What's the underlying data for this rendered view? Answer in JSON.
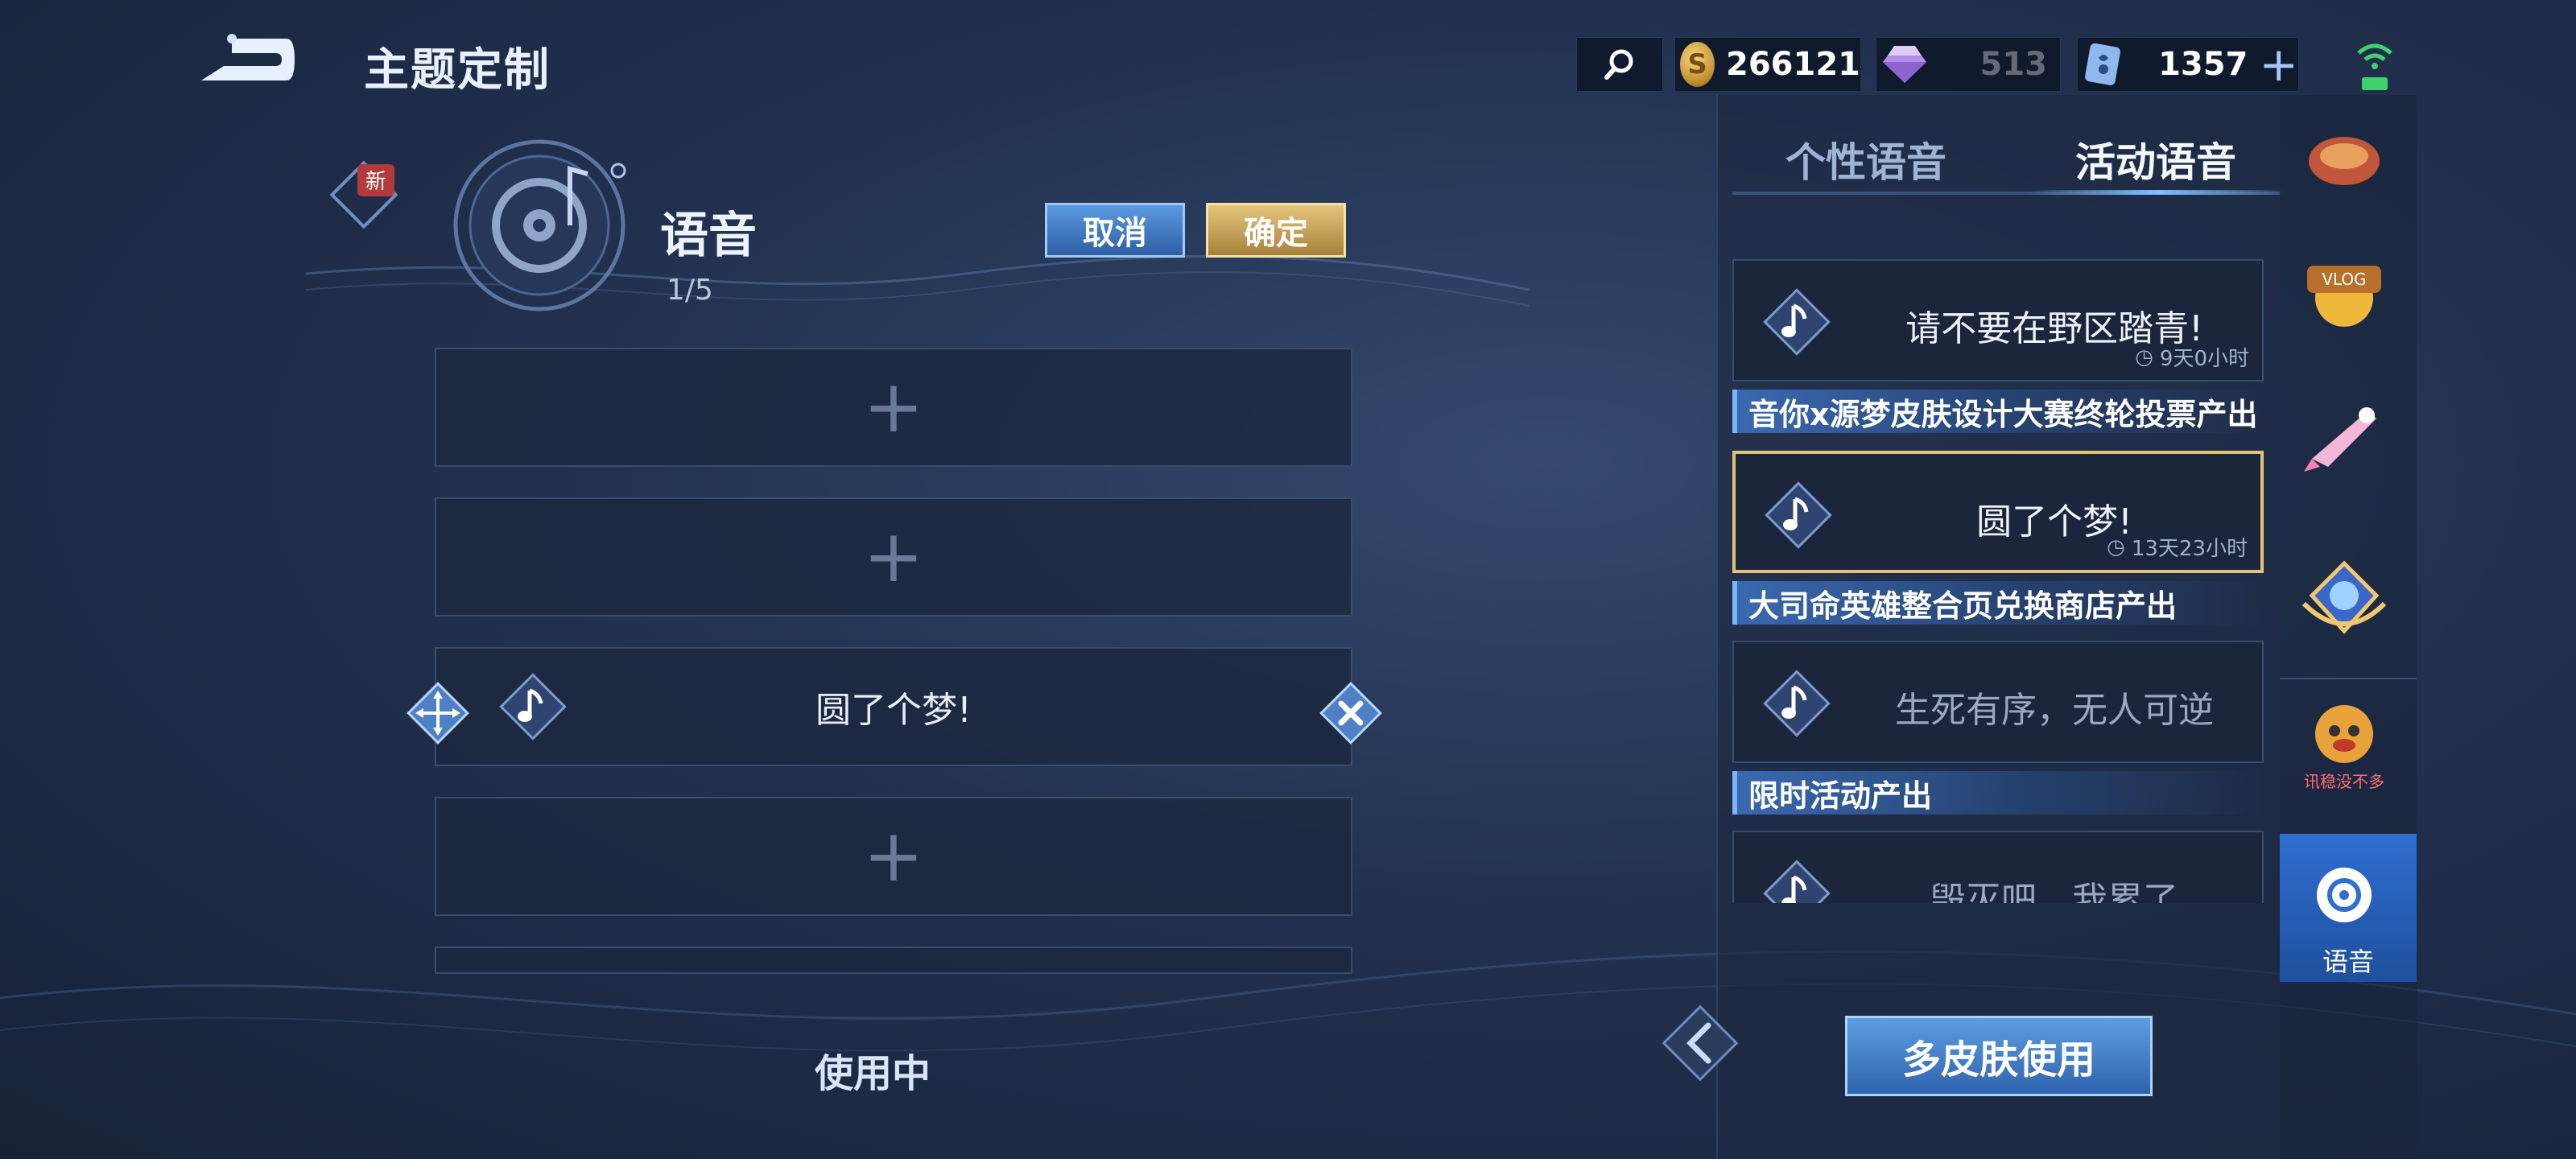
{
  "header": {
    "title": "主题定制",
    "currencies": {
      "gold": "266121",
      "gems": "513",
      "coupons": "1357"
    }
  },
  "voice_section": {
    "title": "语音",
    "count": "1/5",
    "cancel_label": "取消",
    "confirm_label": "确定",
    "new_badge": "新",
    "slots": [
      {
        "filled": false,
        "text": ""
      },
      {
        "filled": false,
        "text": ""
      },
      {
        "filled": true,
        "text": "圆了个梦!"
      },
      {
        "filled": false,
        "text": ""
      }
    ],
    "status": "使用中"
  },
  "right_panel": {
    "tabs": [
      {
        "label": "个性语音",
        "active": false
      },
      {
        "label": "活动语音",
        "active": true
      }
    ],
    "cards": [
      {
        "text": "请不要在野区踏青!",
        "timer": "9天0小时",
        "source": "音你x源梦皮肤设计大赛终轮投票产出"
      },
      {
        "text": "圆了个梦!",
        "timer": "13天23小时",
        "source": "大司命英雄整合页兑换商店产出",
        "selected": true
      },
      {
        "text": "生死有序，无人可逆",
        "timer": "",
        "source": "限时活动产出"
      },
      {
        "text": "毁灭吧，我累了",
        "timer": "",
        "source": ""
      }
    ],
    "multi_skin_button": "多皮肤使用"
  },
  "rail": {
    "active_label": "语音",
    "icon_names": [
      "emote-icon",
      "vlog-badge-icon",
      "rocket-icon",
      "honor-crest-icon",
      "monkey-sticker-icon",
      "voice-disc-icon"
    ],
    "sticker_text": "讯稳没不多"
  },
  "colors": {
    "accent_blue": "#2e6fd0",
    "confirm_gold": "#e3c277",
    "bg": "#22314f"
  }
}
